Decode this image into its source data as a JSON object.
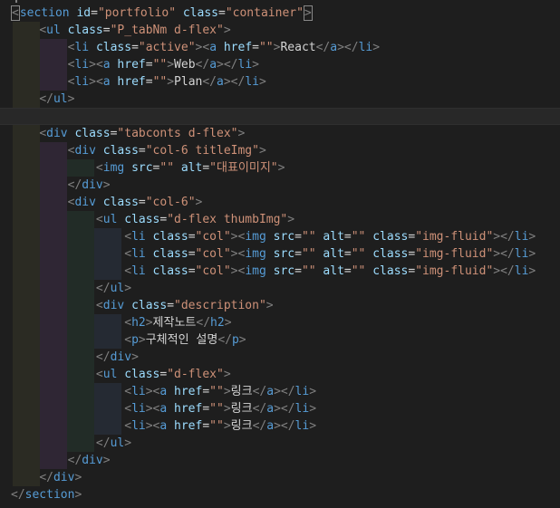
{
  "editor": {
    "language": "html",
    "theme_colors": {
      "background": "#1e1e1e",
      "tag": "#569cd6",
      "bracket": "#808080",
      "attribute": "#9cdcfe",
      "string": "#ce9178",
      "text": "#d4d4d4"
    },
    "lines": [
      {
        "code": "<section id=\"portfolio\" class=\"container\">"
      },
      {
        "code": "    <ul class=\"P_tabNm d-flex\">"
      },
      {
        "code": "        <li class=\"active\"><a href=\"\">React</a></li>"
      },
      {
        "code": "        <li><a href=\"\">Web</a></li>"
      },
      {
        "code": "        <li><a href=\"\">Plan</a></li>"
      },
      {
        "code": "    </ul>"
      },
      {
        "code": ""
      },
      {
        "code": "    <div class=\"tabconts d-flex\">"
      },
      {
        "code": "        <div class=\"col-6 titleImg\">"
      },
      {
        "code": "            <img src=\"\" alt=\"대표이미지\">"
      },
      {
        "code": "        </div>"
      },
      {
        "code": "        <div class=\"col-6\">"
      },
      {
        "code": "            <ul class=\"d-flex thumbImg\">"
      },
      {
        "code": "                <li class=\"col\"><img src=\"\" alt=\"\" class=\"img-fluid\"></li>"
      },
      {
        "code": "                <li class=\"col\"><img src=\"\" alt=\"\" class=\"img-fluid\"></li>"
      },
      {
        "code": "                <li class=\"col\"><img src=\"\" alt=\"\" class=\"img-fluid\"></li>"
      },
      {
        "code": "            </ul>"
      },
      {
        "code": "            <div class=\"description\">"
      },
      {
        "code": "                <h2>제작노트</h2>"
      },
      {
        "code": "                <p>구체적인 설명</p>"
      },
      {
        "code": "            </div>"
      },
      {
        "code": "            <ul class=\"d-flex\">"
      },
      {
        "code": "                <li><a href=\"\">링크</a></li>"
      },
      {
        "code": "                <li><a href=\"\">링크</a></li>"
      },
      {
        "code": "                <li><a href=\"\">링크</a></li>"
      },
      {
        "code": "            </ul>"
      },
      {
        "code": "        </div>"
      },
      {
        "code": "    </div>"
      },
      {
        "code": "</section>"
      }
    ]
  }
}
